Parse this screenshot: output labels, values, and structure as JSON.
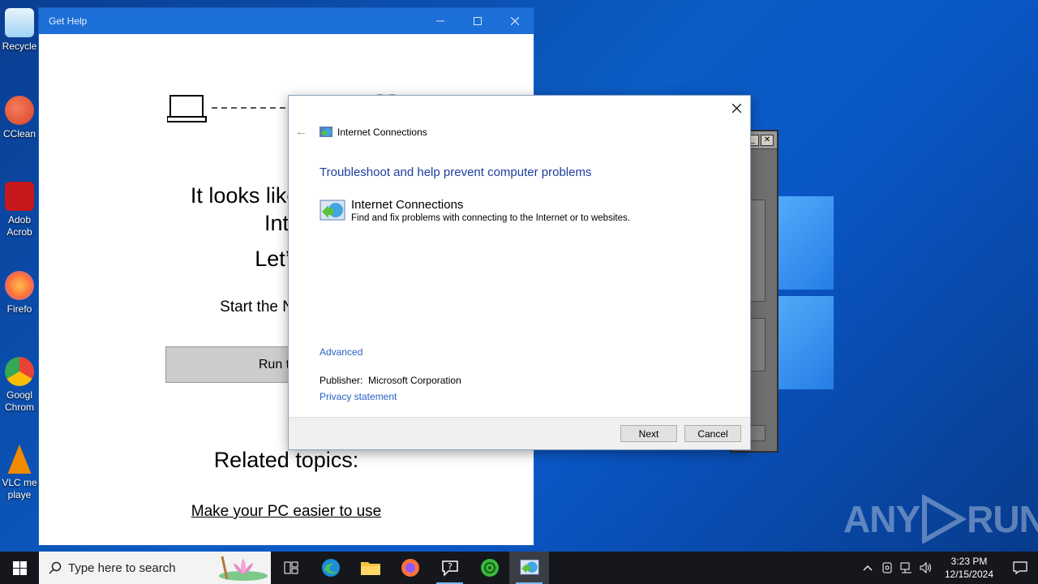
{
  "desktop": {
    "icons": [
      {
        "label": "Recycle",
        "icon": "recycle-bin-icon",
        "color": "#9fd3f5"
      },
      {
        "label": "CClean",
        "icon": "ccleaner-icon",
        "color": "#d9442a"
      },
      {
        "label": "Adob\nAcrob",
        "icon": "adobe-acrobat-icon",
        "color": "#c8161d"
      },
      {
        "label": "Firefo",
        "icon": "firefox-icon",
        "color": "#ff7139"
      },
      {
        "label": "Googl\nChrom",
        "icon": "chrome-icon",
        "color": "#34a853"
      },
      {
        "label": "VLC me\nplaye",
        "icon": "vlc-icon",
        "color": "#f08a00"
      }
    ]
  },
  "gethelp": {
    "title": "Get Help",
    "heading_line1": "It looks like you're n",
    "heading_line2": "Inter",
    "heading_line3": "Let’s fi",
    "subtext": "Start the Network tr",
    "run_button": "Run troub",
    "related_title": "Related topics:",
    "related_link": "Make your PC easier to use"
  },
  "dialog": {
    "window_title": "Internet Connections",
    "heading": "Troubleshoot and help prevent computer problems",
    "item_name": "Internet Connections",
    "item_desc": "Find and fix problems with connecting to the Internet or to websites.",
    "advanced_link": "Advanced",
    "publisher_label": "Publisher:",
    "publisher_value": "Microsoft Corporation",
    "privacy_link": "Privacy statement",
    "next_button": "Next",
    "cancel_button": "Cancel"
  },
  "taskbar": {
    "search_placeholder": "Type here to search",
    "apps": [
      "task-view-icon",
      "edge-icon",
      "file-explorer-icon",
      "firefox-icon",
      "help-icon",
      "network-app-icon",
      "troubleshooter-icon"
    ],
    "time": "3:23 PM",
    "date": "12/15/2024"
  },
  "watermark": {
    "text_left": "ANY",
    "text_right": "RUN"
  },
  "colors": {
    "accent": "#1c6fd6",
    "link": "#2b62c4",
    "heading": "#1e3e9c",
    "taskbar": "#15171d"
  }
}
